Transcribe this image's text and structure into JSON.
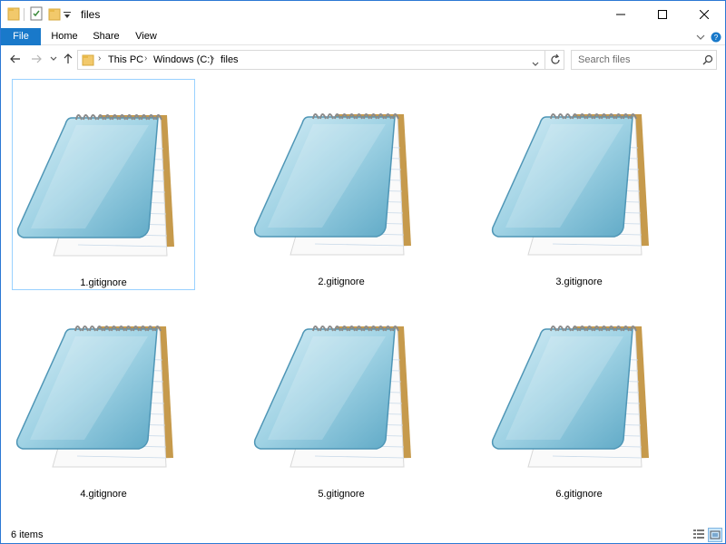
{
  "window": {
    "title": "files",
    "accent": "#1979ca"
  },
  "ribbon": {
    "tabs": [
      {
        "label": "File"
      },
      {
        "label": "Home"
      },
      {
        "label": "Share"
      },
      {
        "label": "View"
      }
    ]
  },
  "address": {
    "path": [
      "This PC",
      "Windows (C:)",
      "files"
    ]
  },
  "search": {
    "placeholder": "Search files"
  },
  "files": [
    {
      "name": "1.gitignore",
      "selected": true,
      "icon": "notepad-icon"
    },
    {
      "name": "2.gitignore",
      "selected": false,
      "icon": "notepad-icon"
    },
    {
      "name": "3.gitignore",
      "selected": false,
      "icon": "notepad-icon"
    },
    {
      "name": "4.gitignore",
      "selected": false,
      "icon": "notepad-icon"
    },
    {
      "name": "5.gitignore",
      "selected": false,
      "icon": "notepad-icon"
    },
    {
      "name": "6.gitignore",
      "selected": false,
      "icon": "notepad-icon"
    }
  ],
  "status": {
    "item_count": "6 items"
  }
}
